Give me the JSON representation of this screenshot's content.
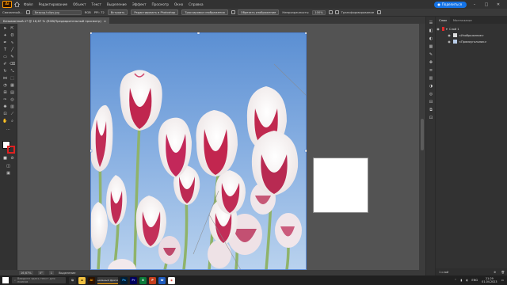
{
  "app": {
    "logo_text": "Ai"
  },
  "menu": [
    "Файл",
    "Редактирование",
    "Объект",
    "Текст",
    "Выделение",
    "Эффект",
    "Просмотр",
    "Окно",
    "Справка"
  ],
  "share_button": "Поделиться",
  "control_bar": {
    "object_label": "Связанный...",
    "filename": "Безрод.tulips.jpg",
    "color_mode": "RGB",
    "ppi": "PPI: 72",
    "embed_button": "Встроить",
    "edit_original_button": "Редактировать в Photoshop",
    "trace_button": "Трассировка изображения",
    "mask_button": "Обрезать изображение",
    "opacity_label": "Непрозрачность:",
    "opacity_value": "100%",
    "transform_button": "Трансформирование"
  },
  "document_tab": {
    "title": "Безымянный-1* @ 16,67 % (RGB/Предварительный просмотр)",
    "close": "×"
  },
  "status_bar": {
    "zoom": "16,67%",
    "rotation": "0°",
    "page": "1",
    "tool": "Выделение"
  },
  "layers_panel": {
    "tab_layers": "Слои",
    "tab_artboards": "Монтажные",
    "layer_name": "Слой 1",
    "items": [
      "<Изображение>",
      "<Прямоугольник>"
    ],
    "footer_count": "1 слой"
  },
  "taskbar": {
    "search_placeholder": "Введите здесь текст для поиска",
    "active_app_label": "Безымянный фрагмент",
    "language": "ENG",
    "time": "21:29",
    "date": "01.04.2023"
  },
  "colors": {
    "accent": "#1473e6",
    "illustrator_orange": "#ff9a00",
    "stroke_swatch": "#e02020"
  }
}
